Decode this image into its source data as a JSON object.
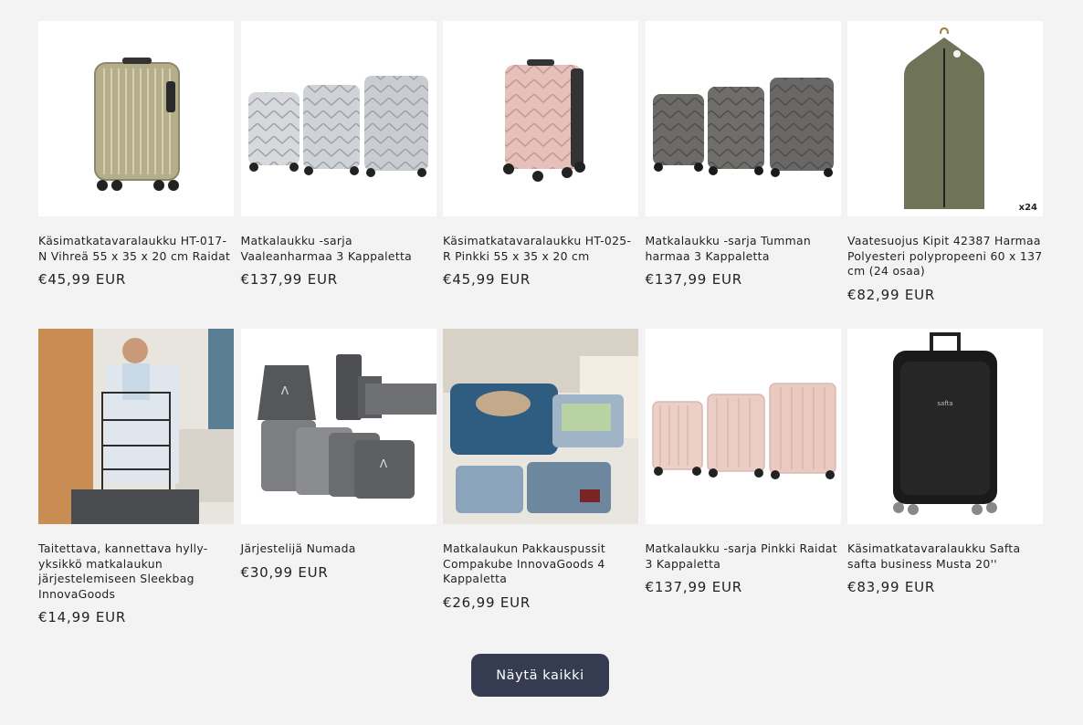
{
  "products": [
    {
      "title": "Käsimatkatavaralaukku HT-017-N Vihreä 55 x 35 x 20 cm Raidat",
      "price": "€45,99 EUR",
      "image": "olive-suitcase-image"
    },
    {
      "title": "Matkalaukku -sarja Vaaleanharmaa 3 Kappaletta",
      "price": "€137,99 EUR",
      "image": "silver-suitcase-set-image"
    },
    {
      "title": "Käsimatkatavaralaukku HT-025-R Pinkki 55 x 35 x 20 cm",
      "price": "€45,99 EUR",
      "image": "pink-suitcase-image"
    },
    {
      "title": "Matkalaukku -sarja Tumman harmaa 3 Kappaletta",
      "price": "€137,99 EUR",
      "image": "dark-grey-suitcase-set-image"
    },
    {
      "title": "Vaatesuojus Kipit 42387 Harmaa Polyesteri polypropeeni 60 x 137 cm (24 osaa)",
      "price": "€82,99 EUR",
      "image": "garment-bag-image",
      "badge": "x24"
    },
    {
      "title": "Taitettava, kannettava hylly-yksikkö matkalaukun järjestelemiseen Sleekbag InnovaGoods",
      "price": "€14,99 EUR",
      "image": "shelf-organizer-image"
    },
    {
      "title": "Järjestelijä Numada",
      "price": "€30,99 EUR",
      "image": "organizer-set-image"
    },
    {
      "title": "Matkalaukun Pakkauspussit Compakube InnovaGoods 4 Kappaletta",
      "price": "€26,99 EUR",
      "image": "packing-cubes-image"
    },
    {
      "title": "Matkalaukku -sarja Pinkki Raidat 3 Kappaletta",
      "price": "€137,99 EUR",
      "image": "pink-striped-suitcase-set-image"
    },
    {
      "title": "Käsimatkatavaralaukku Safta safta business Musta 20''",
      "price": "€83,99 EUR",
      "image": "black-suitcase-image"
    }
  ],
  "view_all_label": "Näytä kaikki"
}
